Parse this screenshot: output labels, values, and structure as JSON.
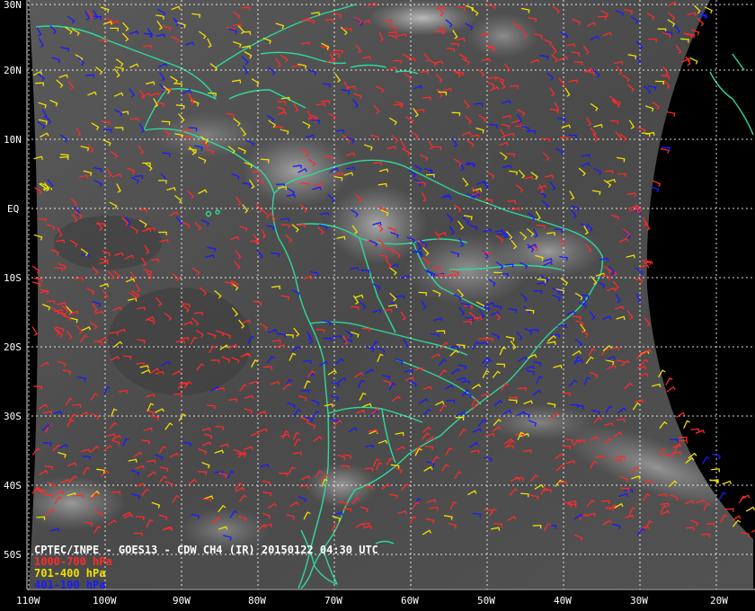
{
  "caption": {
    "title": "CPTEC/INPE - GOES13 - CDW CH4 (IR) 20150122 04:30 UTC",
    "legend": [
      {
        "label": "1000-700 hPa",
        "color": "#ff2a2a"
      },
      {
        "label": "701-400 hPa",
        "color": "#f0e000"
      },
      {
        "label": "401-100 hPa",
        "color": "#1a1aff"
      }
    ]
  },
  "colors": {
    "background": "#000000",
    "coastline": "#2fd99a",
    "grid": "#ffffff",
    "label": "#ffffff"
  },
  "lat_labels": [
    "30N",
    "20N",
    "10N",
    "EQ",
    "10S",
    "20S",
    "30S",
    "40S",
    "50S"
  ],
  "lon_labels": [
    "110W",
    "100W",
    "90W",
    "80W",
    "70W",
    "60W",
    "50W",
    "40W",
    "30W",
    "20W"
  ]
}
